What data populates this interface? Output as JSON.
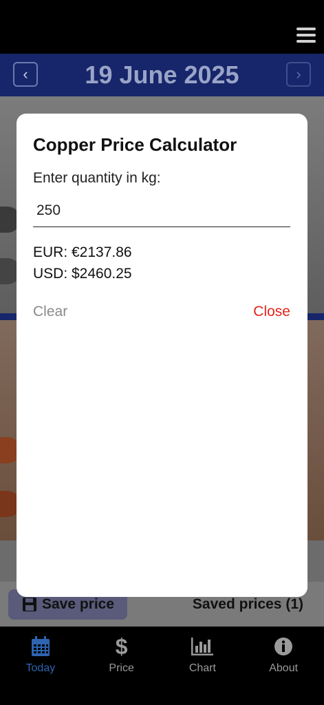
{
  "header": {
    "date": "19 June 2025",
    "prev_glyph": "‹",
    "next_glyph": "›"
  },
  "dialog": {
    "title": "Copper Price Calculator",
    "quantity_label": "Enter quantity in kg:",
    "quantity_value": "250",
    "eur_result": "EUR: €2137.86",
    "usd_result": "USD: $2460.25",
    "clear_label": "Clear",
    "close_label": "Close"
  },
  "actions": {
    "save_label": "Save price",
    "saved_label": "Saved prices (1)"
  },
  "bottom_nav": {
    "items": [
      {
        "label": "Today",
        "icon": "calendar-icon",
        "active": true
      },
      {
        "label": "Price",
        "icon": "dollar-icon",
        "active": false
      },
      {
        "label": "Chart",
        "icon": "bar-chart-icon",
        "active": false
      },
      {
        "label": "About",
        "icon": "info-icon",
        "active": false
      }
    ]
  },
  "colors": {
    "header_bg": "#17266a",
    "close_red": "#e0251b",
    "active_blue": "#2e64b0"
  }
}
